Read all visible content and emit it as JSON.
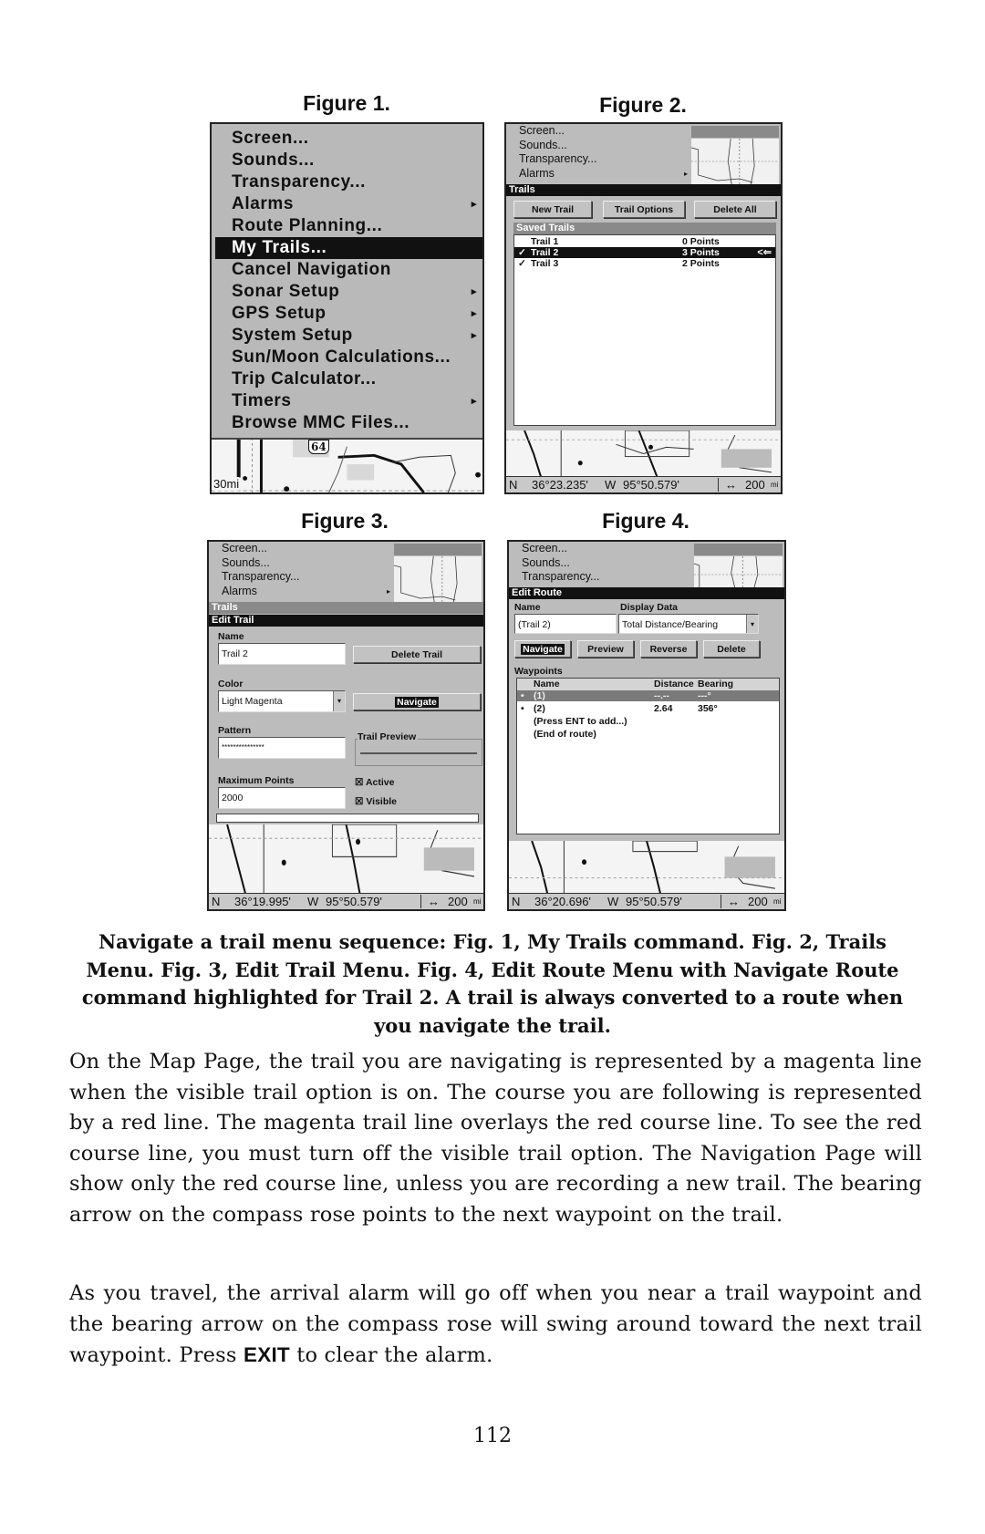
{
  "figures": {
    "fig1": {
      "title": "Figure 1.",
      "menu_items": [
        {
          "label": "Screen...",
          "submenu": false,
          "selected": false
        },
        {
          "label": "Sounds...",
          "submenu": false,
          "selected": false
        },
        {
          "label": "Transparency...",
          "submenu": false,
          "selected": false
        },
        {
          "label": "Alarms",
          "submenu": true,
          "selected": false
        },
        {
          "label": "Route Planning...",
          "submenu": false,
          "selected": false
        },
        {
          "label": "My Trails...",
          "submenu": false,
          "selected": true
        },
        {
          "label": "Cancel Navigation",
          "submenu": false,
          "selected": false
        },
        {
          "label": "Sonar Setup",
          "submenu": true,
          "selected": false
        },
        {
          "label": "GPS Setup",
          "submenu": true,
          "selected": false
        },
        {
          "label": "System Setup",
          "submenu": true,
          "selected": false
        },
        {
          "label": "Sun/Moon Calculations...",
          "submenu": false,
          "selected": false
        },
        {
          "label": "Trip Calculator...",
          "submenu": false,
          "selected": false
        },
        {
          "label": "Timers",
          "submenu": true,
          "selected": false
        },
        {
          "label": "Browse MMC Files...",
          "submenu": false,
          "selected": false
        }
      ],
      "map_scale": "30mi",
      "map_highway_label": "64",
      "submenu_arrow": "▸"
    },
    "fig2": {
      "title": "Figure 2.",
      "menu_items": [
        "Screen...",
        "Sounds...",
        "Transparency...",
        "Alarms"
      ],
      "submenu_arrow": "▸",
      "header": "Trails",
      "buttons": [
        "New Trail",
        "Trail Options",
        "Delete All"
      ],
      "list_header": "Saved Trails",
      "trails": [
        {
          "check": "",
          "name": "Trail 1",
          "points": "0 Points",
          "selected": false
        },
        {
          "check": "✓",
          "name": "Trail 2",
          "points": "3 Points",
          "selected": true
        },
        {
          "check": "✓",
          "name": "Trail 3",
          "points": "2 Points",
          "selected": false
        }
      ],
      "cursor_glyph": "<⇐",
      "status": {
        "lat_hemi": "N",
        "lat": "36°23.235'",
        "lon_hemi": "W",
        "lon": "95°50.579'",
        "range_icon": "↔",
        "range": "200",
        "range_unit": "mi"
      }
    },
    "fig3": {
      "title": "Figure 3.",
      "menu_items": [
        "Screen...",
        "Sounds...",
        "Transparency...",
        "Alarms"
      ],
      "submenu_arrow": "▸",
      "header_trails": "Trails",
      "header": "Edit Trail",
      "name_label": "Name",
      "name_value": "Trail 2",
      "delete_button": "Delete Trail",
      "color_label": "Color",
      "color_value": "Light Magenta",
      "dropdown_glyph": "▾",
      "navigate_button": "Navigate",
      "pattern_label": "Pattern",
      "pattern_value": "***************",
      "preview_label": "Trail Preview",
      "max_points_label": "Maximum Points",
      "max_points_value": "2000",
      "active_label": "Active",
      "active_checked": true,
      "visible_label": "Visible",
      "visible_checked": true,
      "check_glyph": "☒",
      "status": {
        "lat_hemi": "N",
        "lat": "36°19.995'",
        "lon_hemi": "W",
        "lon": "95°50.579'",
        "range_icon": "↔",
        "range": "200",
        "range_unit": "mi"
      }
    },
    "fig4": {
      "title": "Figure 4.",
      "menu_items": [
        "Screen...",
        "Sounds...",
        "Transparency..."
      ],
      "header": "Edit Route",
      "name_label": "Name",
      "name_value": "(Trail 2)",
      "display_label": "Display Data",
      "display_value": "Total Distance/Bearing",
      "dropdown_glyph": "▾",
      "buttons": [
        "Navigate",
        "Preview",
        "Reverse",
        "Delete"
      ],
      "waypoints_label": "Waypoints",
      "columns": [
        "Name",
        "Distance",
        "Bearing"
      ],
      "waypoints": [
        {
          "bullet": "•",
          "name": "(1)",
          "distance": "--.--",
          "bearing": "---°",
          "selected": true
        },
        {
          "bullet": "•",
          "name": "(2)",
          "distance": "2.64",
          "bearing": "356°",
          "selected": false
        }
      ],
      "add_hint": "(Press ENT to add...)",
      "end_hint": "(End of route)",
      "status": {
        "lat_hemi": "N",
        "lat": "36°20.696'",
        "lon_hemi": "W",
        "lon": "95°50.579'",
        "range_icon": "↔",
        "range": "200",
        "range_unit": "mi"
      }
    }
  },
  "caption": "Navigate a trail menu sequence: Fig. 1, My Trails command. Fig. 2, Trails Menu. Fig. 3, Edit Trail Menu. Fig. 4, Edit Route Menu with Navigate Route command highlighted for Trail 2. A trail is always converted to a route when you navigate the trail.",
  "body": {
    "paragraph1": "On the Map Page, the trail you are navigating is represented by a magenta line when the visible trail option is on. The course you are following is represented by a red line. The magenta trail line overlays the red course line. To see the red course line, you must turn off the visible trail option. The Navigation Page will show only the red course line, unless you are recording a new trail. The bearing arrow on the compass rose points to the next waypoint on the trail.",
    "paragraph2_before": "As you travel, the arrival alarm will go off when you near a trail waypoint and the bearing arrow on the compass rose will swing around toward the next trail waypoint. Press",
    "paragraph2_key": "EXIT",
    "paragraph2_after": "to clear the alarm."
  },
  "page_number": "112"
}
